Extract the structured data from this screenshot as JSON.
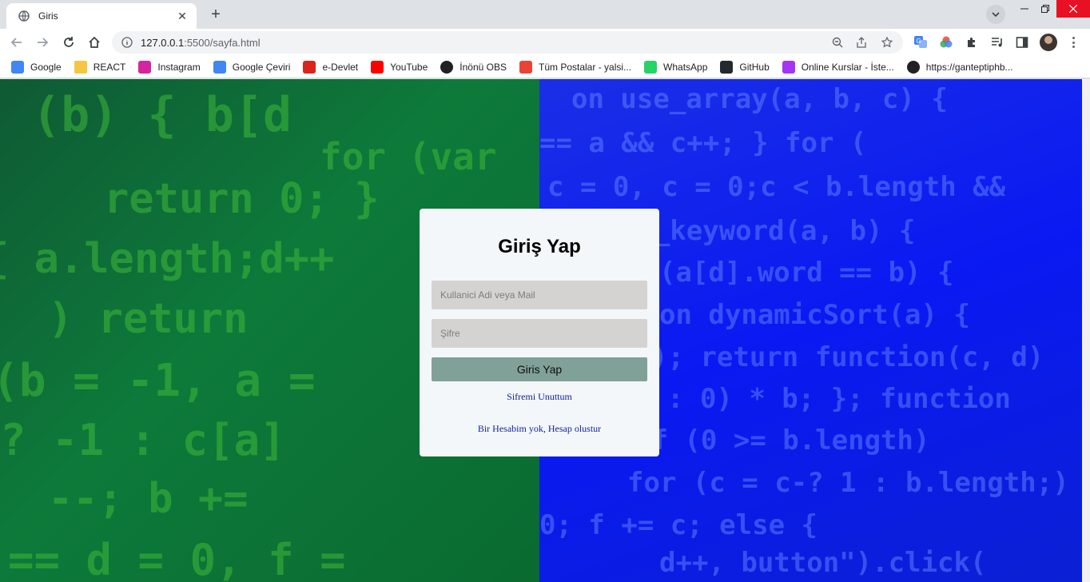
{
  "browser": {
    "tab_title": "Giris",
    "url_host": "127.0.0.1",
    "url_path": ":5500/sayfa.html",
    "accent_close": "#e81123"
  },
  "bookmarks": [
    {
      "label": "Google",
      "icon": "google-icon",
      "color": "#4285f4"
    },
    {
      "label": "REACT",
      "icon": "folder-icon",
      "color": "#f6c544"
    },
    {
      "label": "Instagram",
      "icon": "instagram-icon",
      "color": "#d6249f"
    },
    {
      "label": "Google Çeviri",
      "icon": "translate-icon",
      "color": "#4285f4"
    },
    {
      "label": "e-Devlet",
      "icon": "edevlet-icon",
      "color": "#d9251c"
    },
    {
      "label": "YouTube",
      "icon": "youtube-icon",
      "color": "#ff0000"
    },
    {
      "label": "İnönü OBS",
      "icon": "globe-icon",
      "color": "#202124"
    },
    {
      "label": "Tüm Postalar - yalsi...",
      "icon": "gmail-icon",
      "color": "#ea4335"
    },
    {
      "label": "WhatsApp",
      "icon": "whatsapp-icon",
      "color": "#25d366"
    },
    {
      "label": "GitHub",
      "icon": "github-icon",
      "color": "#24292f"
    },
    {
      "label": "Online Kurslar - İste...",
      "icon": "udemy-icon",
      "color": "#a435f0"
    },
    {
      "label": "https://ganteptiphb...",
      "icon": "globe-icon",
      "color": "#202124"
    }
  ],
  "login": {
    "title": "Giriş Yap",
    "username_placeholder": "Kullanici Adi veya Mail",
    "password_placeholder": "Şifre",
    "submit_label": "Giris Yap",
    "forgot_label": "Sifremi Unuttum",
    "register_label": "Bir Hesabim yok, Hesap olustur",
    "colors": {
      "card": "#f4f7f9",
      "field": "#d5d2d2",
      "button": "#80a197",
      "link": "#0f1f9a"
    }
  },
  "background": {
    "left_color": "#0d7a3a",
    "right_color": "#0a19f2"
  }
}
